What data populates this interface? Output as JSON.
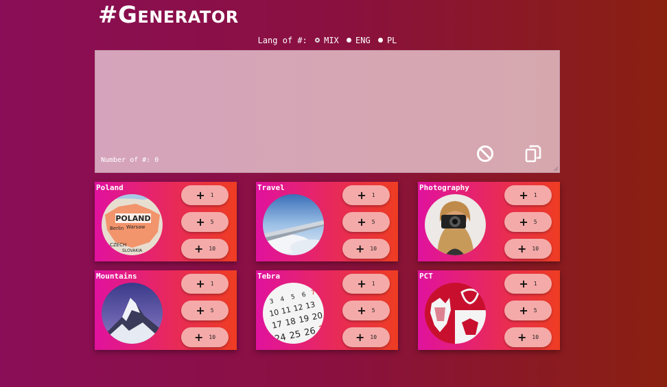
{
  "app": {
    "title": "#Generator"
  },
  "lang": {
    "label": "Lang of #:",
    "options": [
      {
        "label": "MIX",
        "checked": true
      },
      {
        "label": "ENG",
        "checked": false
      },
      {
        "label": "PL",
        "checked": false
      }
    ]
  },
  "editor": {
    "count_label": "Number of #: 0"
  },
  "icons": {
    "clear": "block-icon",
    "copy": "copy-icon"
  },
  "categories": [
    {
      "name": "Poland",
      "buttons": [
        "1",
        "5",
        "10"
      ]
    },
    {
      "name": "Travel",
      "buttons": [
        "1",
        "5",
        "10"
      ]
    },
    {
      "name": "Photography",
      "buttons": [
        "1",
        "5",
        "10"
      ]
    },
    {
      "name": "Mountains",
      "buttons": [
        "1",
        "5",
        "10"
      ]
    },
    {
      "name": "Tebra",
      "buttons": [
        "1",
        "5",
        "10"
      ]
    },
    {
      "name": "PCT",
      "buttons": [
        "1",
        "5",
        "10"
      ]
    }
  ],
  "colors": {
    "card_start": "#e0129e",
    "card_end": "#ee3d22",
    "button": "#f4aaa8"
  }
}
